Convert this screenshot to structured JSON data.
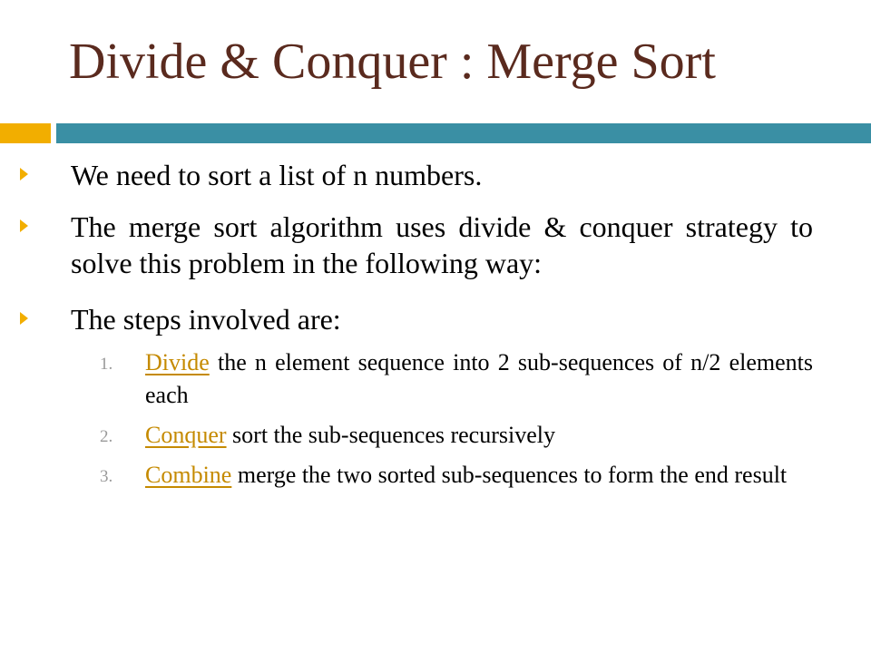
{
  "slide": {
    "title": "Divide & Conquer : Merge Sort",
    "bullets": [
      {
        "text": "We need to sort a list of n numbers."
      },
      {
        "text": "The merge sort algorithm uses divide & conquer strategy to solve this problem in the following way:"
      },
      {
        "text": "The steps involved are:"
      }
    ],
    "steps": [
      {
        "number": "1.",
        "keyword": "Divide",
        "text": " the n element sequence into 2 sub-sequences of n/2 elements each"
      },
      {
        "number": "2.",
        "keyword": "Conquer",
        "text": " sort the sub-sequences recursively"
      },
      {
        "number": "3.",
        "keyword": "Combine",
        "text": " merge the two sorted sub-sequences to form the end result"
      }
    ]
  },
  "colors": {
    "title": "#5a2a1e",
    "accent_orange": "#f2ae00",
    "accent_teal": "#3a8fa4",
    "keyword": "#c58a00",
    "step_number": "#9a9a9a"
  }
}
